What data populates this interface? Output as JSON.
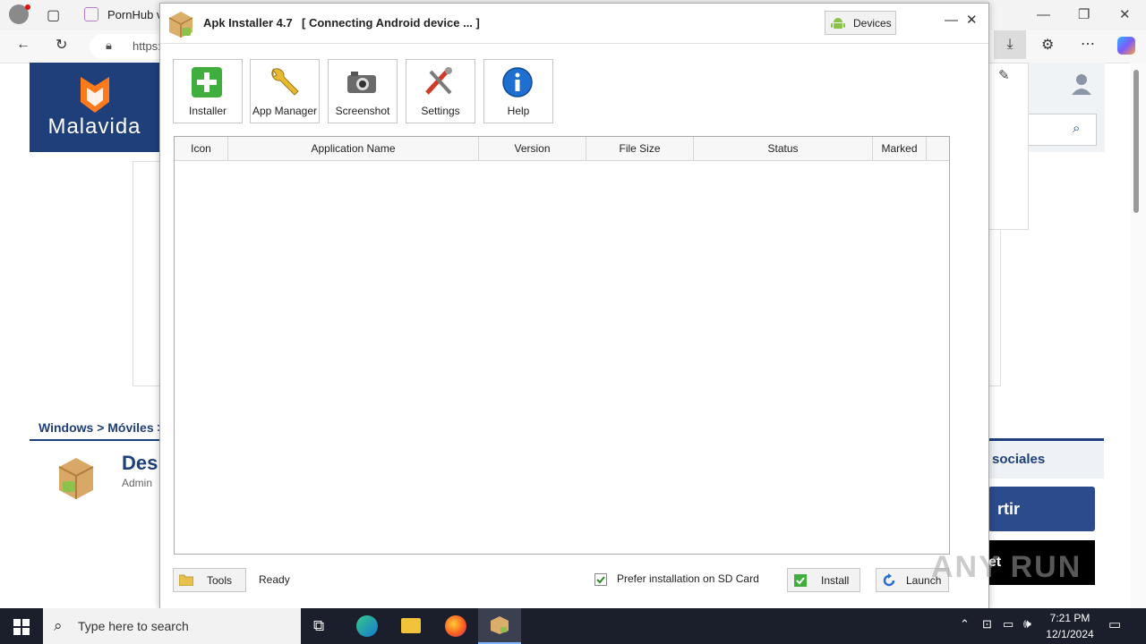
{
  "browser": {
    "tab_title": "PornHub v",
    "url_fragment": "https:",
    "window_controls": {
      "minimize": "—",
      "restore": "❐",
      "close": "✕"
    }
  },
  "page": {
    "logo_text": "Malavida",
    "breadcrumb": "Windows > Móviles >",
    "title_fragment": "Des",
    "author_fragment": "Admin",
    "social_title": "sociales",
    "share_button": "rtir",
    "black_button": "et"
  },
  "app": {
    "name": "Apk Installer 4.7",
    "status_title": "[ Connecting Android device ... ]",
    "devices_label": "Devices",
    "toolbar": [
      {
        "label": "Installer",
        "icon": "plus-icon"
      },
      {
        "label": "App Manager",
        "icon": "wrench-icon"
      },
      {
        "label": "Screenshot",
        "icon": "camera-icon"
      },
      {
        "label": "Settings",
        "icon": "tools-icon"
      },
      {
        "label": "Help",
        "icon": "info-icon"
      }
    ],
    "table_columns": [
      "Icon",
      "Application Name",
      "Version",
      "File Size",
      "Status",
      "Marked"
    ],
    "tools_label": "Tools",
    "status_text": "Ready",
    "sd_card_label": "Prefer installation on SD Card",
    "sd_card_checked": true,
    "install_label": "Install",
    "launch_label": "Launch"
  },
  "taskbar": {
    "search_placeholder": "Type here to search",
    "time": "7:21 PM",
    "date": "12/1/2024"
  },
  "watermark": "ANY RUN",
  "colors": {
    "accent": "#1e3f7a",
    "taskbar": "#1a1f2b",
    "android_green": "#8bc34a"
  }
}
